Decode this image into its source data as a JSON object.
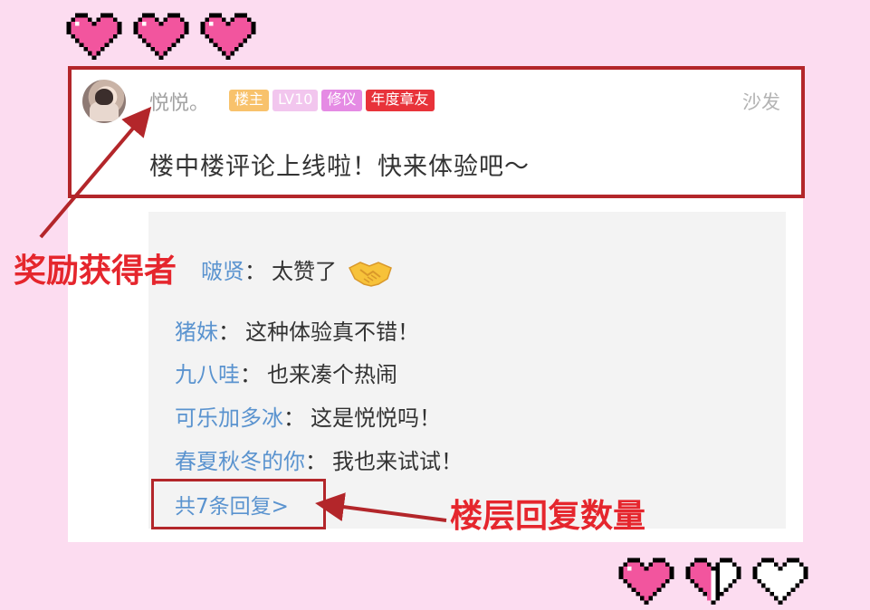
{
  "post": {
    "username": "悦悦。",
    "badges": {
      "owner": "楼主",
      "level": "LV10",
      "title": "修仪",
      "annual": "年度章友"
    },
    "position_label": "沙发",
    "text": "楼中楼评论上线啦！快来体验吧～"
  },
  "replies": [
    {
      "name": "啵贤",
      "colon": "：",
      "text": "太赞了",
      "icon": "handshake-emoji"
    },
    {
      "name": "猪妹",
      "colon": "：",
      "text": "这种体验真不错！"
    },
    {
      "name": "九八哇",
      "colon": "：",
      "text": "也来凑个热闹"
    },
    {
      "name": "可乐加多冰",
      "colon": "：",
      "text": "这是悦悦吗！"
    },
    {
      "name": "春夏秋冬的你",
      "colon": "：",
      "text": "我也来试试！"
    }
  ],
  "more_replies": "共7条回复>",
  "annotations": {
    "reward_winner": "奖励获得者",
    "reply_count": "楼层回复数量"
  },
  "colors": {
    "background": "#fcdcf0",
    "highlight_border": "#b3262a",
    "callout_text": "#e5262d",
    "link": "#5a93cf",
    "heart": "#f2559e"
  },
  "decor": {
    "top_hearts": [
      "heart-full-icon",
      "heart-full-icon",
      "heart-full-icon"
    ],
    "bottom_hearts": [
      "heart-full-icon",
      "heart-half-icon",
      "heart-empty-icon"
    ]
  }
}
